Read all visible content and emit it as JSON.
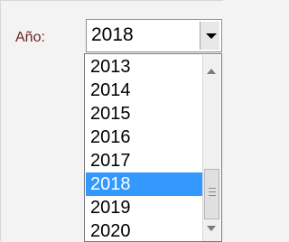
{
  "form": {
    "year_label": "Año:",
    "year_value": "2018"
  },
  "dropdown": {
    "items": [
      {
        "label": "2013",
        "selected": false
      },
      {
        "label": "2014",
        "selected": false
      },
      {
        "label": "2015",
        "selected": false
      },
      {
        "label": "2016",
        "selected": false
      },
      {
        "label": "2017",
        "selected": false
      },
      {
        "label": "2018",
        "selected": true
      },
      {
        "label": "2019",
        "selected": false
      },
      {
        "label": "2020",
        "selected": false
      }
    ]
  },
  "icons": {
    "combo_arrow": "chevron-down-icon",
    "scroll_up": "chevron-up-icon",
    "scroll_down": "chevron-down-icon"
  },
  "colors": {
    "label_text": "#6a1f1f",
    "selection": "#3399ff"
  }
}
